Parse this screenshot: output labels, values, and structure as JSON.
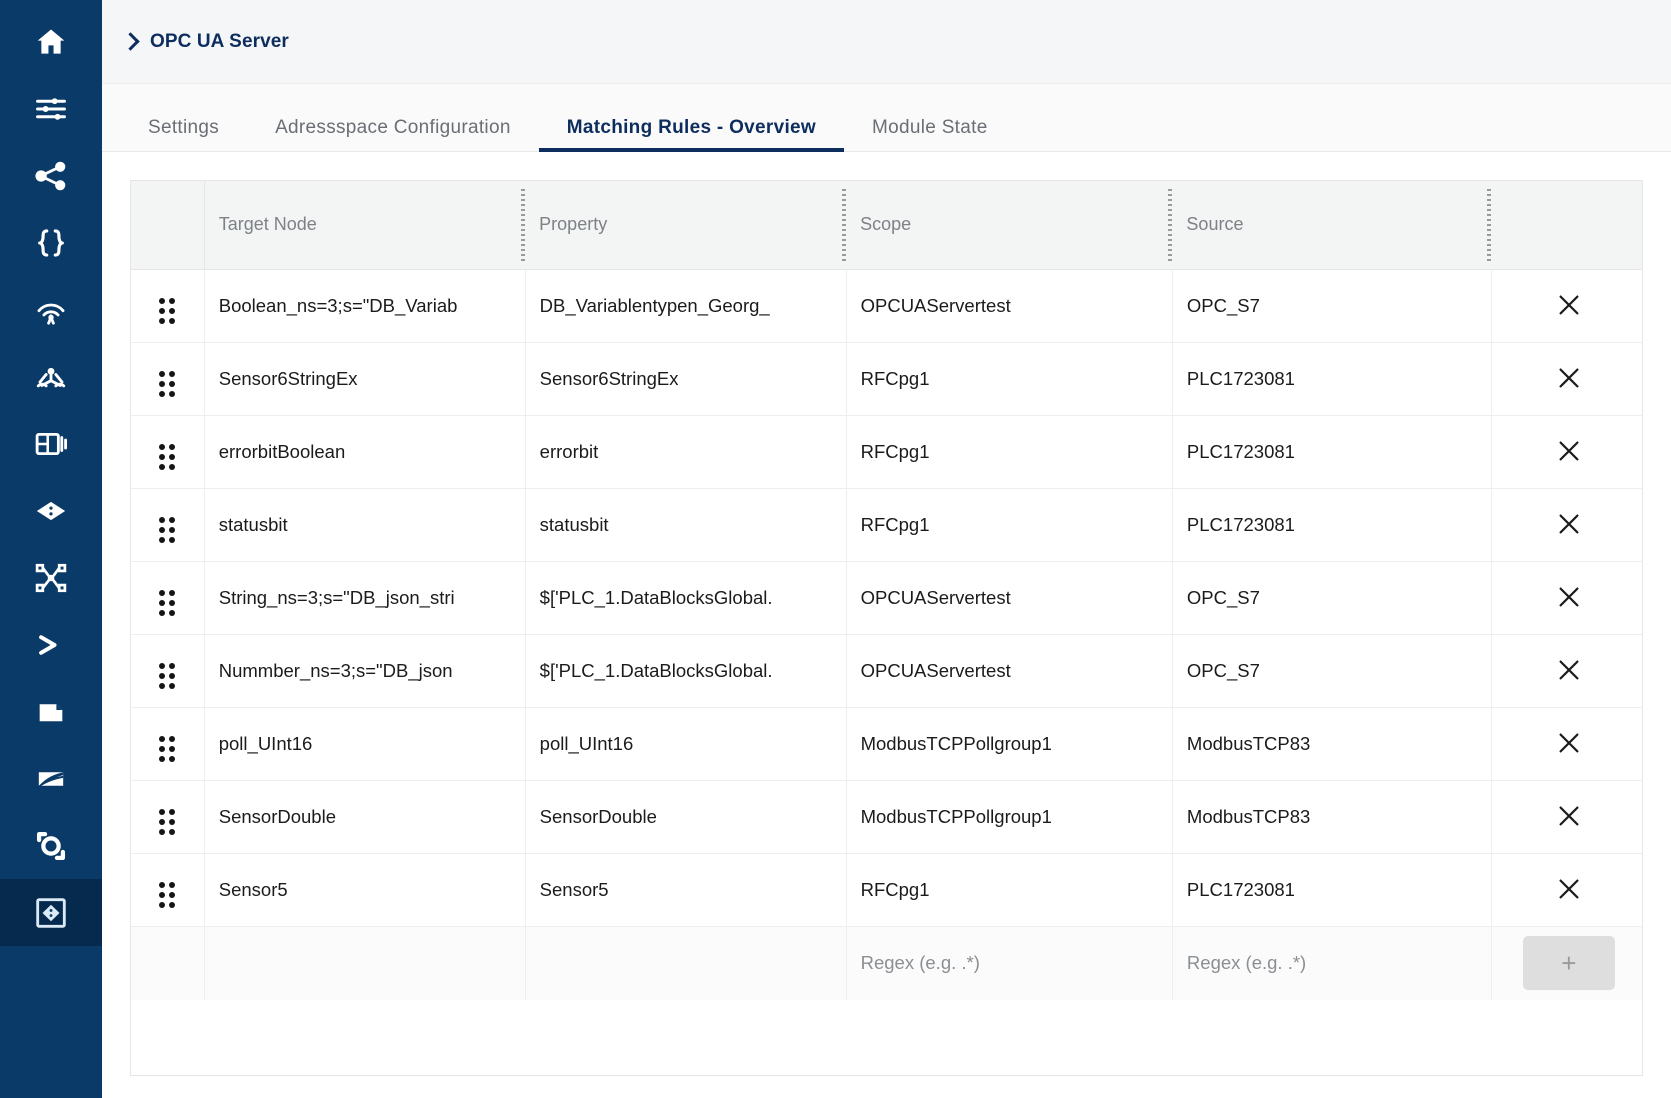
{
  "sidebar": {
    "items": [
      {
        "icon": "home-icon",
        "name": "sidebar-item-home",
        "active": false
      },
      {
        "icon": "sliders-icon",
        "name": "sidebar-item-settings",
        "active": false
      },
      {
        "icon": "share-icon",
        "name": "sidebar-item-connections",
        "active": false
      },
      {
        "icon": "braces-icon",
        "name": "sidebar-item-json",
        "active": false
      },
      {
        "icon": "broadcast-icon",
        "name": "sidebar-item-mqtt",
        "active": false
      },
      {
        "icon": "hub-icon",
        "name": "sidebar-item-hub",
        "active": false
      },
      {
        "icon": "dashboard-icon",
        "name": "sidebar-item-dashboard",
        "active": false
      },
      {
        "icon": "diamond-icon",
        "name": "sidebar-item-node",
        "active": false
      },
      {
        "icon": "flow-icon",
        "name": "sidebar-item-flow",
        "active": false
      },
      {
        "icon": "terminal-icon",
        "name": "sidebar-item-terminal",
        "active": false
      },
      {
        "icon": "file-icon",
        "name": "sidebar-item-files",
        "active": false
      },
      {
        "icon": "layers-icon",
        "name": "sidebar-item-layers",
        "active": false
      },
      {
        "icon": "target-icon",
        "name": "sidebar-item-target",
        "active": false
      },
      {
        "icon": "opcua-icon",
        "name": "sidebar-item-opcua-server",
        "active": true
      }
    ]
  },
  "breadcrumb": {
    "chevron": "chevron-right-icon",
    "title": "OPC UA Server"
  },
  "tabs": [
    {
      "label": "Settings",
      "active": false
    },
    {
      "label": "Adressspace Configuration",
      "active": false
    },
    {
      "label": "Matching Rules - Overview",
      "active": true
    },
    {
      "label": "Module State",
      "active": false
    }
  ],
  "table": {
    "columns": [
      "Target Node",
      "Property",
      "Scope",
      "Source"
    ],
    "rows": [
      {
        "target": "Boolean_ns=3;s=\"DB_Variab",
        "property": "DB_Variablentypen_Georg_",
        "scope": "OPCUAServertest",
        "source": "OPC_S7",
        "delete": "close-icon"
      },
      {
        "target": "Sensor6StringEx",
        "property": "Sensor6StringEx",
        "scope": "RFCpg1",
        "source": "PLC1723081",
        "delete": "close-icon"
      },
      {
        "target": "errorbitBoolean",
        "property": "errorbit",
        "scope": "RFCpg1",
        "source": "PLC1723081",
        "delete": "close-icon"
      },
      {
        "target": "statusbit",
        "property": "statusbit",
        "scope": "RFCpg1",
        "source": "PLC1723081",
        "delete": "close-icon"
      },
      {
        "target": "String_ns=3;s=\"DB_json_stri",
        "property": "$['PLC_1.DataBlocksGlobal.",
        "scope": "OPCUAServertest",
        "source": "OPC_S7",
        "delete": "close-icon"
      },
      {
        "target": "Nummber_ns=3;s=\"DB_json",
        "property": "$['PLC_1.DataBlocksGlobal.",
        "scope": "OPCUAServertest",
        "source": "OPC_S7",
        "delete": "close-icon"
      },
      {
        "target": "poll_UInt16",
        "property": "poll_UInt16",
        "scope": "ModbusTCPPollgroup1",
        "source": "ModbusTCP83",
        "delete": "close-icon"
      },
      {
        "target": "SensorDouble",
        "property": "SensorDouble",
        "scope": "ModbusTCPPollgroup1",
        "source": "ModbusTCP83",
        "delete": "close-icon"
      },
      {
        "target": "Sensor5",
        "property": "Sensor5",
        "scope": "RFCpg1",
        "source": "PLC1723081",
        "delete": "close-icon"
      }
    ],
    "new_row": {
      "target_value": "",
      "target_placeholder": "",
      "property_value": "",
      "property_placeholder": "",
      "scope_value": "",
      "scope_placeholder": "Regex (e.g. .*)",
      "source_value": "",
      "source_placeholder": "Regex (e.g. .*)",
      "add_label": "+"
    }
  },
  "colors": {
    "sidebar_bg": "#0a3a68",
    "sidebar_active_bg": "#062a4d",
    "accent": "#0d2d5e",
    "header_bg": "#f3f4f4",
    "tab_inactive": "#6a6f76"
  }
}
